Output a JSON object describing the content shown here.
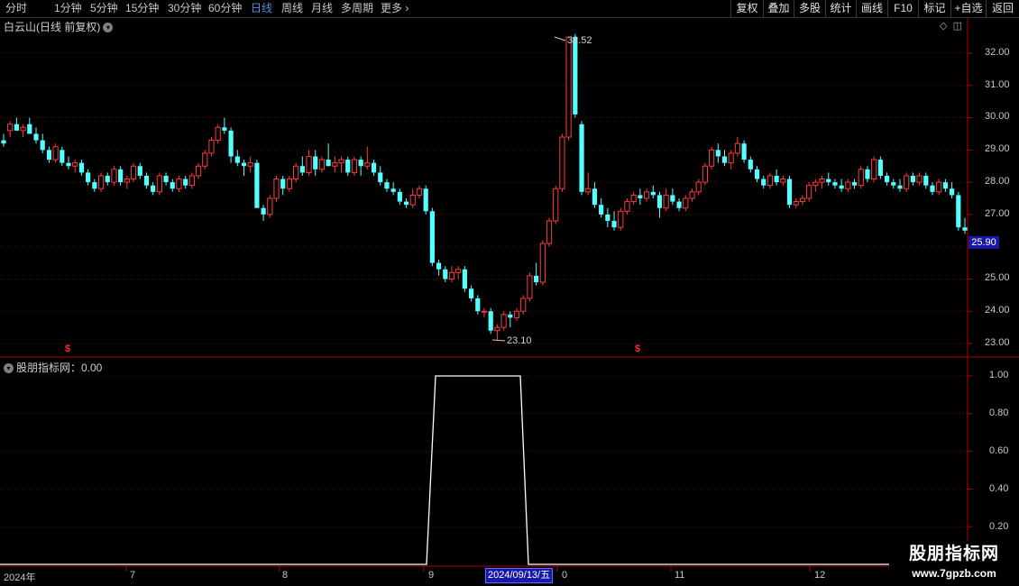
{
  "toolbar": {
    "periods": [
      "分时",
      "1分钟",
      "5分钟",
      "15分钟",
      "30分钟",
      "60分钟",
      "日线",
      "周线",
      "月线",
      "多周期",
      "更多"
    ],
    "active_period": "日线",
    "buttons": [
      "复权",
      "叠加",
      "多股",
      "统计",
      "画线",
      "F10",
      "标记",
      "+自选",
      "返回"
    ]
  },
  "main_title": "白云山(日线 前复权)",
  "indicator_title": "股朋指标网：0.00",
  "price_axis": [
    "32.00",
    "31.00",
    "30.00",
    "29.00",
    "28.00",
    "27.00",
    "25.00",
    "24.00",
    "23.00"
  ],
  "current_price": "25.90",
  "high_label": "32.52",
  "low_label": "23.10",
  "indicator_axis": [
    "1.00",
    "0.80",
    "0.60",
    "0.40",
    "0.20"
  ],
  "x_axis": [
    "2024年",
    "7",
    "8",
    "9",
    "0",
    "11",
    "12"
  ],
  "cursor_date": "2024/09/13/五",
  "marker_symbol": "$",
  "watermark": {
    "line1": "股朋指标网",
    "line2": "www.7gpzb.com"
  },
  "colors": {
    "up": "#ff3c3c",
    "down": "#54ffff",
    "grid": "#7a0000",
    "axis": "#b00000",
    "highlight": "#1717a8"
  },
  "chart_data": {
    "type": "candlestick",
    "ylim": [
      22.6,
      33.0
    ],
    "candles": [
      [
        29.3,
        29.5,
        29.1,
        29.2
      ],
      [
        29.6,
        29.9,
        29.4,
        29.8
      ],
      [
        29.8,
        30.0,
        29.6,
        29.6
      ],
      [
        29.6,
        29.8,
        29.4,
        29.7
      ],
      [
        29.8,
        30.0,
        29.5,
        29.5
      ],
      [
        29.5,
        29.7,
        29.2,
        29.3
      ],
      [
        29.3,
        29.5,
        28.9,
        29.0
      ],
      [
        29.0,
        29.1,
        28.6,
        28.7
      ],
      [
        28.7,
        29.2,
        28.6,
        29.1
      ],
      [
        29.0,
        29.1,
        28.5,
        28.6
      ],
      [
        28.6,
        28.8,
        28.4,
        28.5
      ],
      [
        28.5,
        28.7,
        28.3,
        28.6
      ],
      [
        28.6,
        28.7,
        28.2,
        28.3
      ],
      [
        28.3,
        28.4,
        27.9,
        28.0
      ],
      [
        28.0,
        28.1,
        27.7,
        27.8
      ],
      [
        27.8,
        28.3,
        27.7,
        28.2
      ],
      [
        28.2,
        28.3,
        27.9,
        28.0
      ],
      [
        28.0,
        28.5,
        27.9,
        28.4
      ],
      [
        28.4,
        28.5,
        27.9,
        28.0
      ],
      [
        28.0,
        28.2,
        27.8,
        28.1
      ],
      [
        28.1,
        28.6,
        28.0,
        28.5
      ],
      [
        28.5,
        28.6,
        28.1,
        28.2
      ],
      [
        28.2,
        28.3,
        27.8,
        27.9
      ],
      [
        27.9,
        28.0,
        27.6,
        27.7
      ],
      [
        27.7,
        28.3,
        27.6,
        28.2
      ],
      [
        28.2,
        28.3,
        27.9,
        28.0
      ],
      [
        28.0,
        28.1,
        27.7,
        27.8
      ],
      [
        27.8,
        28.2,
        27.7,
        28.1
      ],
      [
        28.1,
        28.2,
        27.8,
        27.9
      ],
      [
        27.9,
        28.3,
        27.8,
        28.2
      ],
      [
        28.2,
        28.6,
        28.1,
        28.5
      ],
      [
        28.5,
        29.0,
        28.4,
        28.9
      ],
      [
        28.9,
        29.4,
        28.8,
        29.3
      ],
      [
        29.3,
        29.8,
        29.2,
        29.7
      ],
      [
        29.7,
        30.0,
        29.5,
        29.6
      ],
      [
        29.6,
        29.7,
        28.6,
        28.8
      ],
      [
        28.8,
        29.0,
        28.5,
        28.6
      ],
      [
        28.6,
        28.7,
        28.2,
        28.5
      ],
      [
        28.5,
        28.8,
        28.3,
        28.6
      ],
      [
        28.6,
        28.7,
        27.4,
        27.2
      ],
      [
        27.2,
        27.3,
        26.8,
        27.0
      ],
      [
        27.0,
        27.6,
        26.9,
        27.5
      ],
      [
        27.5,
        28.2,
        27.4,
        28.1
      ],
      [
        28.1,
        28.2,
        27.6,
        27.8
      ],
      [
        27.8,
        28.2,
        27.7,
        28.1
      ],
      [
        28.1,
        28.6,
        28.0,
        28.5
      ],
      [
        28.5,
        28.8,
        28.2,
        28.3
      ],
      [
        28.3,
        29.0,
        28.2,
        28.8
      ],
      [
        28.8,
        29.0,
        28.2,
        28.4
      ],
      [
        28.4,
        28.8,
        28.3,
        28.7
      ],
      [
        28.7,
        29.2,
        28.5,
        28.5
      ],
      [
        28.5,
        28.8,
        28.3,
        28.6
      ],
      [
        28.6,
        28.8,
        28.3,
        28.7
      ],
      [
        28.7,
        28.8,
        28.2,
        28.3
      ],
      [
        28.3,
        28.8,
        28.2,
        28.7
      ],
      [
        28.7,
        28.8,
        28.2,
        28.5
      ],
      [
        28.5,
        29.1,
        28.4,
        28.6
      ],
      [
        28.6,
        28.7,
        28.2,
        28.3
      ],
      [
        28.3,
        28.5,
        27.9,
        28.0
      ],
      [
        28.0,
        28.1,
        27.7,
        27.8
      ],
      [
        27.8,
        28.0,
        27.6,
        27.7
      ],
      [
        27.7,
        27.8,
        27.3,
        27.4
      ],
      [
        27.4,
        27.5,
        27.2,
        27.3
      ],
      [
        27.3,
        27.8,
        27.2,
        27.6
      ],
      [
        27.6,
        27.9,
        27.5,
        27.8
      ],
      [
        27.8,
        27.9,
        27.0,
        27.1
      ],
      [
        27.1,
        27.2,
        25.4,
        25.5
      ],
      [
        25.5,
        25.6,
        25.1,
        25.3
      ],
      [
        25.3,
        25.4,
        24.9,
        25.0
      ],
      [
        25.0,
        25.4,
        24.9,
        25.2
      ],
      [
        25.2,
        25.4,
        25.0,
        25.3
      ],
      [
        25.3,
        25.4,
        24.6,
        24.7
      ],
      [
        24.7,
        24.8,
        24.3,
        24.4
      ],
      [
        24.4,
        24.5,
        23.9,
        24.0
      ],
      [
        24.0,
        24.1,
        23.8,
        24.0
      ],
      [
        24.0,
        24.1,
        23.3,
        23.4
      ],
      [
        23.4,
        23.6,
        23.1,
        23.5
      ],
      [
        23.5,
        24.0,
        23.4,
        23.9
      ],
      [
        23.9,
        24.0,
        23.5,
        23.8
      ],
      [
        23.8,
        24.1,
        23.7,
        24.0
      ],
      [
        24.0,
        24.5,
        23.9,
        24.4
      ],
      [
        24.4,
        25.2,
        24.3,
        25.1
      ],
      [
        25.1,
        25.5,
        24.8,
        24.9
      ],
      [
        24.9,
        26.2,
        24.8,
        26.1
      ],
      [
        26.1,
        26.9,
        26.0,
        26.8
      ],
      [
        26.8,
        27.9,
        26.7,
        27.8
      ],
      [
        27.8,
        29.5,
        27.7,
        29.4
      ],
      [
        29.4,
        32.5,
        29.3,
        32.5
      ],
      [
        32.5,
        32.6,
        30.0,
        30.1
      ],
      [
        29.8,
        29.9,
        27.6,
        27.7
      ],
      [
        27.7,
        28.3,
        27.6,
        27.8
      ],
      [
        27.8,
        28.0,
        27.2,
        27.3
      ],
      [
        27.3,
        27.5,
        26.9,
        27.0
      ],
      [
        27.0,
        27.2,
        26.6,
        26.8
      ],
      [
        26.8,
        27.1,
        26.5,
        26.6
      ],
      [
        26.6,
        27.2,
        26.5,
        27.1
      ],
      [
        27.1,
        27.5,
        27.0,
        27.4
      ],
      [
        27.4,
        27.7,
        27.3,
        27.6
      ],
      [
        27.6,
        27.8,
        27.3,
        27.5
      ],
      [
        27.5,
        27.8,
        27.4,
        27.7
      ],
      [
        27.7,
        27.9,
        27.5,
        27.6
      ],
      [
        27.6,
        27.7,
        26.9,
        27.2
      ],
      [
        27.2,
        27.8,
        27.1,
        27.6
      ],
      [
        27.6,
        27.8,
        27.3,
        27.4
      ],
      [
        27.4,
        27.5,
        27.1,
        27.2
      ],
      [
        27.2,
        27.6,
        27.1,
        27.5
      ],
      [
        27.5,
        27.8,
        27.4,
        27.7
      ],
      [
        27.7,
        28.1,
        27.6,
        28.0
      ],
      [
        28.0,
        28.6,
        27.9,
        28.5
      ],
      [
        28.5,
        29.1,
        28.4,
        29.0
      ],
      [
        29.0,
        29.2,
        28.6,
        28.8
      ],
      [
        28.8,
        29.0,
        28.5,
        28.6
      ],
      [
        28.6,
        29.0,
        28.4,
        28.9
      ],
      [
        28.9,
        29.4,
        28.8,
        29.2
      ],
      [
        29.2,
        29.3,
        28.6,
        28.7
      ],
      [
        28.7,
        28.8,
        28.3,
        28.4
      ],
      [
        28.4,
        28.5,
        28.0,
        28.1
      ],
      [
        28.1,
        28.2,
        27.8,
        27.9
      ],
      [
        27.9,
        28.3,
        27.8,
        28.2
      ],
      [
        28.2,
        28.4,
        27.9,
        28.0
      ],
      [
        28.0,
        28.2,
        27.9,
        28.1
      ],
      [
        28.1,
        28.2,
        27.2,
        27.3
      ],
      [
        27.3,
        27.5,
        27.2,
        27.4
      ],
      [
        27.4,
        27.6,
        27.3,
        27.5
      ],
      [
        27.5,
        28.0,
        27.4,
        27.9
      ],
      [
        27.9,
        28.1,
        27.7,
        28.0
      ],
      [
        28.0,
        28.2,
        27.8,
        28.1
      ],
      [
        28.1,
        28.3,
        27.9,
        28.0
      ],
      [
        28.0,
        28.1,
        27.8,
        27.9
      ],
      [
        27.9,
        28.1,
        27.7,
        27.8
      ],
      [
        27.8,
        28.1,
        27.7,
        28.0
      ],
      [
        28.0,
        28.1,
        27.8,
        27.9
      ],
      [
        27.9,
        28.5,
        27.8,
        28.4
      ],
      [
        28.4,
        28.5,
        28.0,
        28.1
      ],
      [
        28.1,
        28.8,
        28.0,
        28.7
      ],
      [
        28.7,
        28.8,
        28.1,
        28.2
      ],
      [
        28.2,
        28.3,
        27.9,
        28.0
      ],
      [
        28.0,
        28.1,
        27.8,
        27.9
      ],
      [
        27.9,
        28.1,
        27.7,
        27.8
      ],
      [
        27.8,
        28.3,
        27.7,
        28.2
      ],
      [
        28.2,
        28.3,
        27.9,
        28.0
      ],
      [
        28.0,
        28.3,
        27.9,
        28.2
      ],
      [
        28.2,
        28.3,
        27.8,
        27.9
      ],
      [
        27.9,
        28.0,
        27.6,
        27.7
      ],
      [
        27.7,
        28.1,
        27.6,
        28.0
      ],
      [
        28.0,
        28.1,
        27.7,
        27.8
      ],
      [
        27.8,
        28.0,
        27.5,
        27.6
      ],
      [
        27.6,
        27.7,
        26.5,
        26.6
      ],
      [
        26.6,
        26.9,
        26.4,
        26.5
      ]
    ],
    "indicator": {
      "ylim": [
        0,
        1.0
      ],
      "segments": [
        [
          0,
          0
        ],
        [
          473,
          0
        ],
        [
          483,
          1
        ],
        [
          577,
          1
        ],
        [
          586,
          0
        ],
        [
          1072,
          0
        ]
      ]
    }
  }
}
